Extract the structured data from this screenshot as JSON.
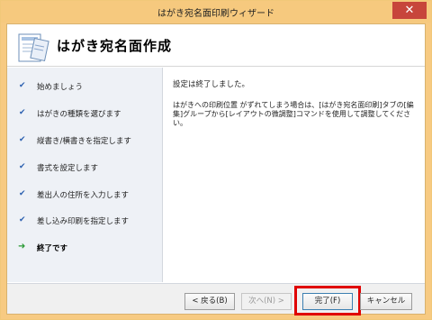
{
  "window": {
    "title": "はがき宛名面印刷ウィザード",
    "close_label": "✕"
  },
  "header": {
    "title": "はがき宛名面作成"
  },
  "steps": [
    {
      "label": "始めましょう",
      "done": true
    },
    {
      "label": "はがきの種類を選びます",
      "done": true
    },
    {
      "label": "縦書き/横書きを指定します",
      "done": true
    },
    {
      "label": "書式を設定します",
      "done": true
    },
    {
      "label": "差出人の住所を入力します",
      "done": true
    },
    {
      "label": "差し込み印刷を指定します",
      "done": true
    },
    {
      "label": "終了です",
      "current": true
    }
  ],
  "icons": {
    "check": "✔",
    "arrow": "➜"
  },
  "main": {
    "status": "設定は終了しました。",
    "info": "はがきへの印刷位置 がずれてしまう場合は、[はがき宛名面印刷]タブの[編集]グループから[レイアウトの微調整]コマンドを使用して調整してください。"
  },
  "buttons": {
    "back": "< 戻る(B)",
    "next": "次へ(N) >",
    "finish": "完了(F)",
    "cancel": "キャンセル"
  },
  "colors": {
    "titlebar": "#f6c97e",
    "close": "#c7453b",
    "highlight": "#e00000",
    "check": "#2d61b0",
    "arrow": "#2a9a34"
  }
}
